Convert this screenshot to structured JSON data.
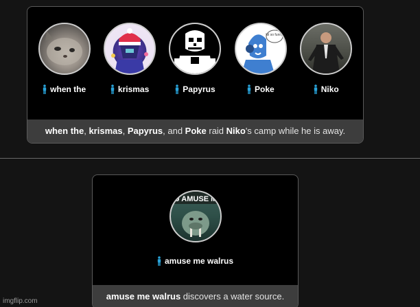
{
  "event1": {
    "tributes": [
      {
        "name": "when the",
        "avatar": "blurry-cat-face"
      },
      {
        "name": "krismas",
        "avatar": "kris-christmas-art"
      },
      {
        "name": "Papyrus",
        "avatar": "papyrus-skeleton"
      },
      {
        "name": "Poke",
        "avatar": "blue-headphones-sketch"
      },
      {
        "name": "Niko",
        "avatar": "niko-suit-man"
      }
    ],
    "caption": {
      "p1": "when the",
      "s1": ", ",
      "p2": "krismas",
      "s2": ", ",
      "p3": "Papyrus",
      "s3": ", and ",
      "p4": "Poke",
      "s4": " raid ",
      "p5": "Niko",
      "s5": "'s camp while he is away."
    },
    "avatar_text": {
      "poke_bubble": "lol so funny"
    }
  },
  "event2": {
    "tributes": [
      {
        "name": "amuse me walrus",
        "avatar": "walrus-meme",
        "meme_text": "U AMUSE M"
      }
    ],
    "caption": {
      "p1": "amuse me walrus",
      "s1": " discovers a water source."
    }
  },
  "watermark": "imgflip.com",
  "colors": {
    "page_bg": "#141414",
    "card_bg": "#000000",
    "caption_bg": "#3d3d3d",
    "person_icon": "#29a3d9"
  }
}
